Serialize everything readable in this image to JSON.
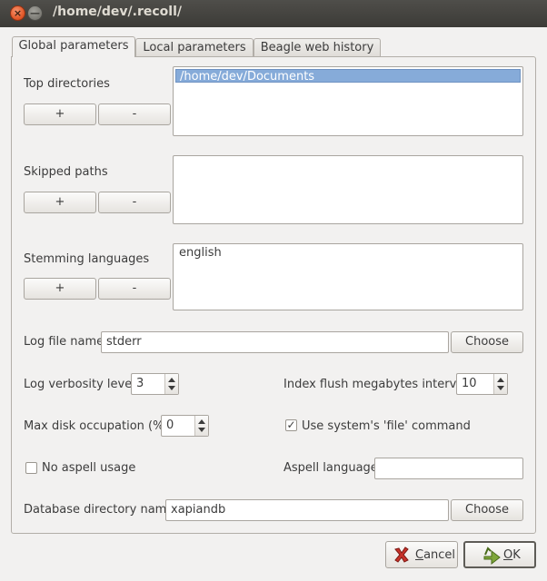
{
  "window": {
    "title": "/home/dev/.recoll/",
    "close_glyph": "×",
    "minimize_glyph": "—"
  },
  "tabs": [
    {
      "label": "Global parameters",
      "active": true
    },
    {
      "label": "Local parameters",
      "active": false
    },
    {
      "label": "Beagle web history",
      "active": false
    }
  ],
  "top_directories": {
    "label": "Top directories",
    "add_label": "+",
    "remove_label": "-",
    "items": [
      "/home/dev/Documents"
    ]
  },
  "skipped_paths": {
    "label": "Skipped paths",
    "add_label": "+",
    "remove_label": "-",
    "items": []
  },
  "stemming_languages": {
    "label": "Stemming languages",
    "add_label": "+",
    "remove_label": "-",
    "items": [
      "english"
    ]
  },
  "log_file": {
    "label": "Log file name",
    "value": "stderr",
    "choose_label": "Choose"
  },
  "log_verbosity": {
    "label": "Log verbosity level",
    "value": "3"
  },
  "index_flush": {
    "label": "Index flush megabytes interval",
    "value": "10"
  },
  "max_disk": {
    "label": "Max disk occupation (%)",
    "value": "0"
  },
  "use_file_command": {
    "label": "Use system's 'file' command",
    "checked": true,
    "check_glyph": "✓"
  },
  "no_aspell": {
    "label": "No aspell usage",
    "checked": false
  },
  "aspell_language": {
    "label": "Aspell language",
    "value": ""
  },
  "database_dir": {
    "label": "Database directory name",
    "value": "xapiandb",
    "choose_label": "Choose"
  },
  "buttons": {
    "cancel_first": "C",
    "cancel_rest": "ancel",
    "ok_first": "O",
    "ok_rest": "K",
    "cancel_icon": "red-x-icon",
    "ok_icon": "green-check-arrow-icon"
  }
}
